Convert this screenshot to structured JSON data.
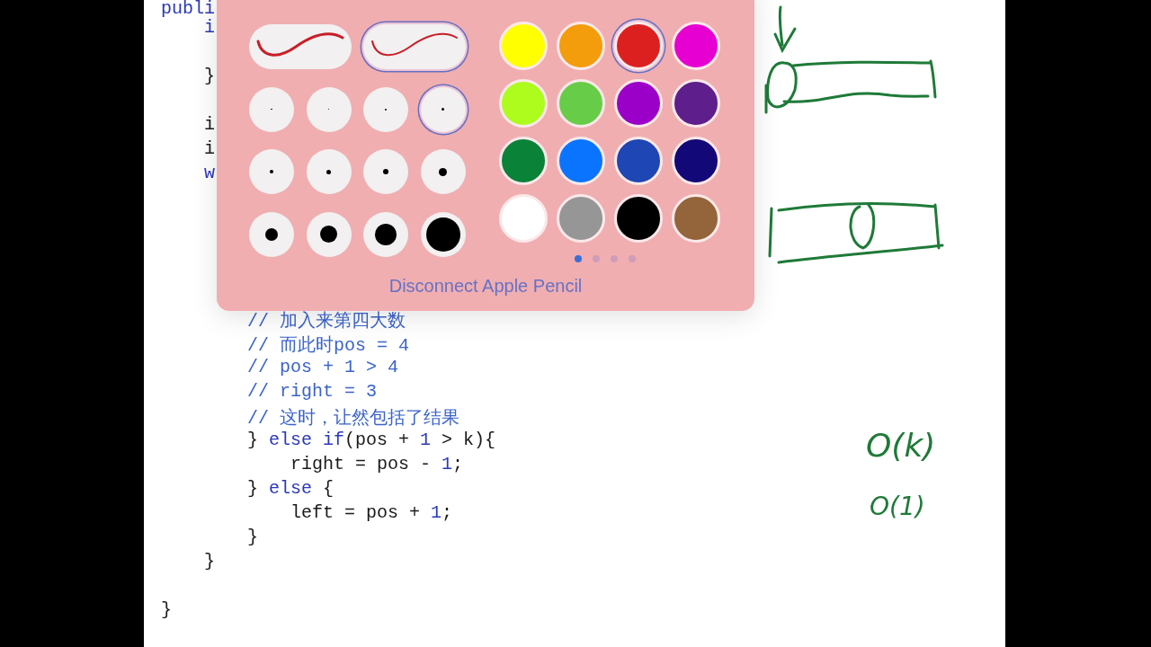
{
  "code_lines": [
    {
      "kind": "code",
      "segments": [
        {
          "text": "publi",
          "kind": "keyword"
        }
      ]
    },
    {
      "kind": "code",
      "segments": [
        {
          "text": "    i",
          "kind": "keyword"
        }
      ]
    },
    {
      "kind": "blank"
    },
    {
      "kind": "code",
      "segments": [
        {
          "text": "    }",
          "kind": "plain"
        }
      ]
    },
    {
      "kind": "blank"
    },
    {
      "kind": "code",
      "segments": [
        {
          "text": "    i",
          "kind": "plain"
        }
      ]
    },
    {
      "kind": "code",
      "segments": [
        {
          "text": "    i",
          "kind": "plain"
        }
      ]
    },
    {
      "kind": "code",
      "segments": [
        {
          "text": "    w",
          "kind": "keyword"
        }
      ]
    },
    {
      "kind": "blank"
    },
    {
      "kind": "blank"
    },
    {
      "kind": "blank"
    },
    {
      "kind": "blank"
    },
    {
      "kind": "blank"
    },
    {
      "kind": "code",
      "segments": [
        {
          "text": "        // 加入来第四大数",
          "kind": "comment"
        }
      ]
    },
    {
      "kind": "code",
      "segments": [
        {
          "text": "        // 而此时pos = 4",
          "kind": "comment"
        }
      ]
    },
    {
      "kind": "code",
      "segments": [
        {
          "text": "        // pos + 1 > 4",
          "kind": "comment"
        }
      ]
    },
    {
      "kind": "code",
      "segments": [
        {
          "text": "        // right = 3",
          "kind": "comment"
        }
      ]
    },
    {
      "kind": "code",
      "segments": [
        {
          "text": "        // 这时，让然包括了结果",
          "kind": "comment"
        }
      ]
    },
    {
      "kind": "code",
      "segments": [
        {
          "text": "        } ",
          "kind": "plain"
        },
        {
          "text": "else if",
          "kind": "keyword"
        },
        {
          "text": "(pos + ",
          "kind": "plain"
        },
        {
          "text": "1",
          "kind": "number"
        },
        {
          "text": " > k){",
          "kind": "plain"
        }
      ]
    },
    {
      "kind": "code",
      "segments": [
        {
          "text": "            right = pos - ",
          "kind": "plain"
        },
        {
          "text": "1",
          "kind": "number"
        },
        {
          "text": ";",
          "kind": "plain"
        }
      ]
    },
    {
      "kind": "code",
      "segments": [
        {
          "text": "        } ",
          "kind": "plain"
        },
        {
          "text": "else",
          "kind": "keyword"
        },
        {
          "text": " {",
          "kind": "plain"
        }
      ]
    },
    {
      "kind": "code",
      "segments": [
        {
          "text": "            left = pos + ",
          "kind": "plain"
        },
        {
          "text": "1",
          "kind": "number"
        },
        {
          "text": ";",
          "kind": "plain"
        }
      ]
    },
    {
      "kind": "code",
      "segments": [
        {
          "text": "        }",
          "kind": "plain"
        }
      ]
    },
    {
      "kind": "code",
      "segments": [
        {
          "text": "    }",
          "kind": "plain"
        }
      ]
    },
    {
      "kind": "blank"
    },
    {
      "kind": "code",
      "segments": [
        {
          "text": "}",
          "kind": "plain"
        }
      ]
    }
  ],
  "pen_panel": {
    "strokes": [
      {
        "selected": false
      },
      {
        "selected": true
      }
    ],
    "sizes": [
      {
        "selected": false
      },
      {
        "selected": false
      },
      {
        "selected": false
      },
      {
        "selected": true
      },
      {
        "selected": false
      },
      {
        "selected": false
      },
      {
        "selected": false
      },
      {
        "selected": false
      },
      {
        "selected": false
      },
      {
        "selected": false
      },
      {
        "selected": false
      },
      {
        "selected": false
      }
    ],
    "colors": [
      {
        "color": "#ffff00",
        "selected": false
      },
      {
        "color": "#f39c0c",
        "selected": false
      },
      {
        "color": "#dc2020",
        "selected": true
      },
      {
        "color": "#e600d2",
        "selected": false
      },
      {
        "color": "#adfc1e",
        "selected": false
      },
      {
        "color": "#67cd48",
        "selected": false
      },
      {
        "color": "#9b00c8",
        "selected": false
      },
      {
        "color": "#5e1e8c",
        "selected": false
      },
      {
        "color": "#0a8238",
        "selected": false
      },
      {
        "color": "#0a74ff",
        "selected": false
      },
      {
        "color": "#1e46b4",
        "selected": false
      },
      {
        "color": "#120878",
        "selected": false
      },
      {
        "color": "#ffffff",
        "selected": false
      },
      {
        "color": "#969696",
        "selected": false
      },
      {
        "color": "#000000",
        "selected": false
      },
      {
        "color": "#94643a",
        "selected": false
      }
    ],
    "pages": [
      {
        "selected": true
      },
      {
        "selected": false
      },
      {
        "selected": false
      },
      {
        "selected": false
      }
    ],
    "disconnect_button": "Disconnect Apple Pencil"
  },
  "notes": [
    {
      "text": "O(k)"
    },
    {
      "text": "O(1)"
    }
  ]
}
